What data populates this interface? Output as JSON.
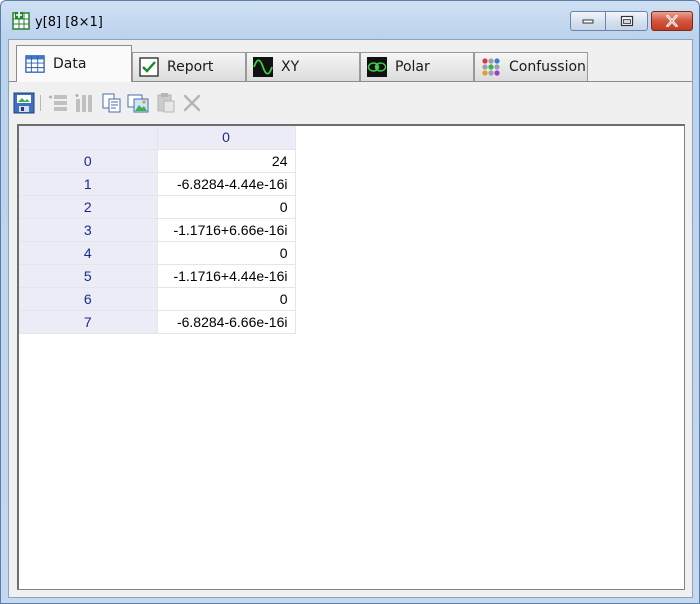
{
  "window": {
    "title": "y[8] [8×1]"
  },
  "tabs": [
    {
      "label": "Data",
      "icon": "table-icon",
      "active": true
    },
    {
      "label": "Report",
      "icon": "checkmark-icon",
      "active": false
    },
    {
      "label": "XY",
      "icon": "sine-wave-icon",
      "active": false
    },
    {
      "label": "Polar",
      "icon": "polar-plot-icon",
      "active": false
    },
    {
      "label": "Confussion",
      "icon": "confusion-dots-icon",
      "active": false
    }
  ],
  "toolbar": {
    "icons": [
      "save-image-icon",
      "insert-row-icon",
      "insert-column-icon",
      "copy-icon",
      "copy-image-icon",
      "paste-icon",
      "delete-icon"
    ]
  },
  "grid": {
    "column_header": "0",
    "rows": [
      {
        "index": "0",
        "value": "24"
      },
      {
        "index": "1",
        "value": "-6.8284-4.44e-16i"
      },
      {
        "index": "2",
        "value": "0"
      },
      {
        "index": "3",
        "value": "-1.1716+6.66e-16i"
      },
      {
        "index": "4",
        "value": "0"
      },
      {
        "index": "5",
        "value": "-1.1716+4.44e-16i"
      },
      {
        "index": "6",
        "value": "0"
      },
      {
        "index": "7",
        "value": "-6.8284-6.66e-16i"
      }
    ]
  },
  "colors": {
    "header_bg": "#ececf7",
    "header_text": "#1c2b8a",
    "close_button": "#c23b23"
  }
}
